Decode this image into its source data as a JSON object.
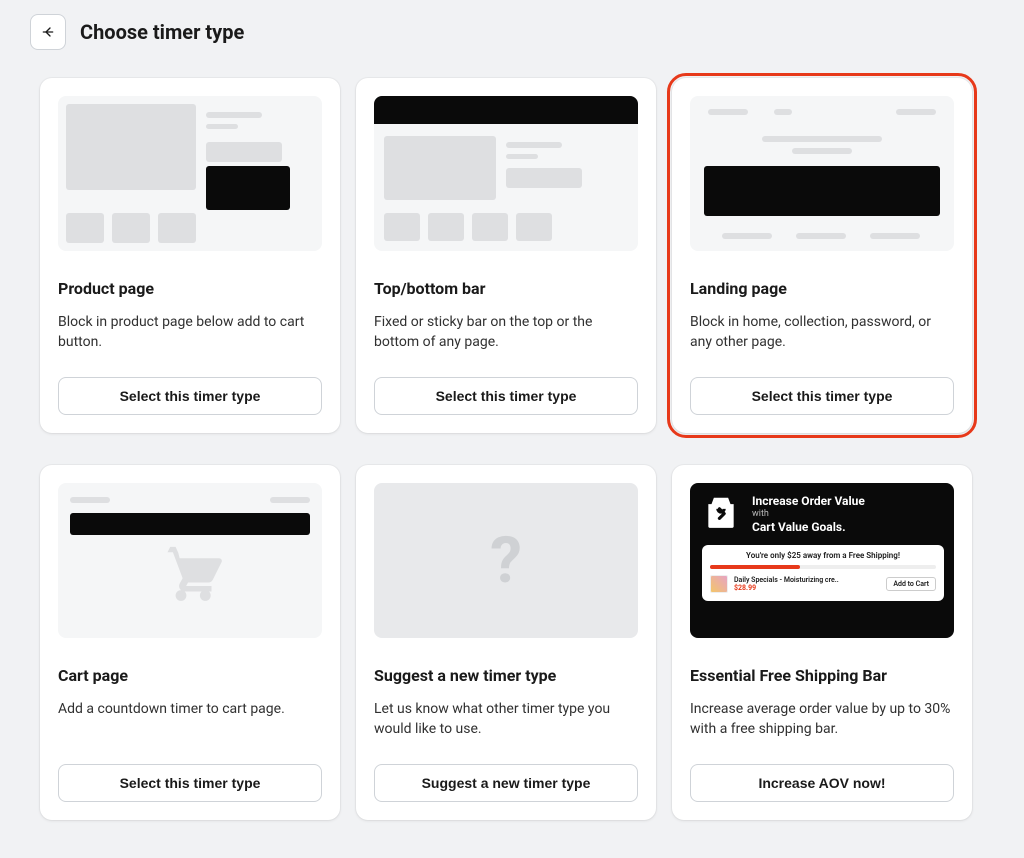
{
  "header": {
    "title": "Choose timer type"
  },
  "cards": [
    {
      "title": "Product page",
      "desc": "Block in product page below add to cart button.",
      "button": "Select this timer type"
    },
    {
      "title": "Top/bottom bar",
      "desc": "Fixed or sticky bar on the top or the bottom of any page.",
      "button": "Select this timer type"
    },
    {
      "title": "Landing page",
      "desc": "Block in home, collection, password, or any other page.",
      "button": "Select this timer type"
    },
    {
      "title": "Cart page",
      "desc": "Add a countdown timer to cart page.",
      "button": "Select this timer type"
    },
    {
      "title": "Suggest a new timer type",
      "desc": "Let us know what other timer type you would like to use.",
      "button": "Suggest a new timer type"
    },
    {
      "title": "Essential Free Shipping Bar",
      "desc": "Increase average order value by up to 30% with a free shipping bar.",
      "button": "Increase AOV now!"
    }
  ],
  "promo": {
    "headline1": "Increase Order Value",
    "with": "with",
    "headline2": "Cart Value Goals.",
    "panel_msg": "You're only $25 away from a Free Shipping!",
    "product_name": "Daily Specials - Moisturizing cre..",
    "product_price": "$28.99",
    "add_to_cart": "Add to Cart"
  }
}
